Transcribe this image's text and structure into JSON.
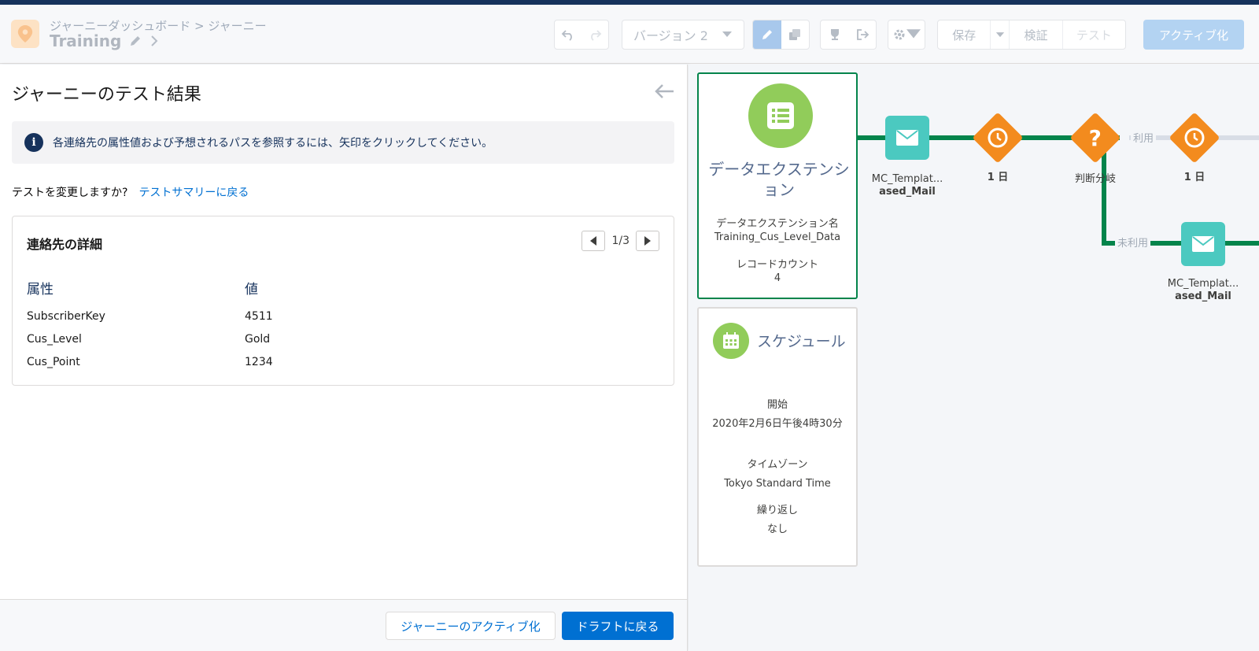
{
  "header": {
    "breadcrumb_parent": "ジャーニーダッシュボード",
    "breadcrumb_sep": ">",
    "breadcrumb_current": "ジャーニー",
    "journey_name": "Training",
    "version_label": "バージョン 2",
    "save_label": "保存",
    "validate_label": "検証",
    "test_label": "テスト",
    "activate_label": "アクティブ化"
  },
  "left_panel": {
    "title": "ジャーニーのテスト結果",
    "info_text": "各連絡先の属性値および予想されるパスを参照するには、矢印をクリックしてください。",
    "change_prompt": "テストを変更しますか?",
    "change_link": "テストサマリーに戻る",
    "contact_card": {
      "title": "連絡先の詳細",
      "pager": "1/3",
      "col_attr": "属性",
      "col_value": "値",
      "rows": [
        {
          "attr": "SubscriberKey",
          "value": "4511"
        },
        {
          "attr": "Cus_Level",
          "value": "Gold"
        },
        {
          "attr": "Cus_Point",
          "value": "1234"
        }
      ]
    },
    "footer": {
      "activate_journey": "ジャーニーのアクティブ化",
      "back_to_draft": "ドラフトに戻る"
    }
  },
  "canvas": {
    "data_extension": {
      "title": "データエクステンション",
      "name_label": "データエクステンション名",
      "name_value": "Training_Cus_Level_Data",
      "count_label": "レコードカウント",
      "count_value": "4"
    },
    "schedule": {
      "title": "スケジュール",
      "start_label": "開始",
      "start_value": "2020年2月6日午後4時30分",
      "tz_label": "タイムゾーン",
      "tz_value": "Tokyo Standard Time",
      "repeat_label": "繰り返し",
      "repeat_value": "なし"
    },
    "nodes": {
      "email1_label_1": "MC_Templat...",
      "email1_label_2": "ased_Mail",
      "wait1_label": "1 日",
      "split_label": "判断分岐",
      "wait2_label": "1 日",
      "email2_label_1": "MC_Templat...",
      "email2_label_2": "ased_Mail",
      "path_yes": "利用",
      "path_no": "未利用"
    },
    "colors": {
      "path_active": "#04844b",
      "email_node": "#4bc9c0",
      "wait_node": "#f38b1e",
      "entry_icon": "#91cc5a"
    }
  }
}
